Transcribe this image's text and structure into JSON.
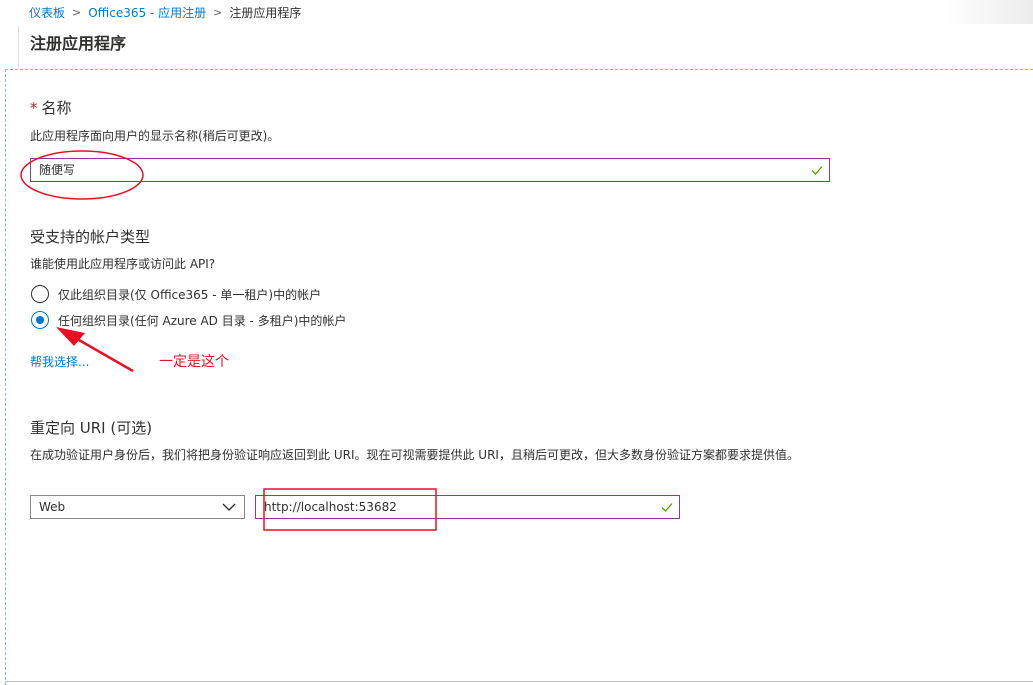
{
  "breadcrumb": {
    "items": [
      "仪表板",
      "Office365 - 应用注册"
    ],
    "current": "注册应用程序"
  },
  "page": {
    "title": "注册应用程序"
  },
  "name_section": {
    "required_mark": "*",
    "title": "名称",
    "description": "此应用程序面向用户的显示名称(稍后可更改)。",
    "value": "随便写"
  },
  "account_section": {
    "title": "受支持的帐户类型",
    "question": "谁能使用此应用程序或访问此 API?",
    "options": [
      {
        "label": "仅此组织目录(仅 Office365 - 单一租户)中的帐户",
        "selected": false
      },
      {
        "label": "任何组织目录(任何 Azure AD 目录 - 多租户)中的帐户",
        "selected": true
      }
    ],
    "help_link": "帮我选择..."
  },
  "redirect_section": {
    "title": "重定向 URI (可选)",
    "description": "在成功验证用户身份后，我们将把身份验证响应返回到此 URI。现在可视需要提供此 URI，且稍后可更改，但大多数身份验证方案都要求提供值。",
    "platform": "Web",
    "uri": "http://localhost:53682"
  },
  "annotation": {
    "text": "一定是这个",
    "color": "#e81123"
  },
  "colors": {
    "accent": "#0078d4",
    "input_border": "#8a3d8d",
    "valid_check": "#57a300"
  }
}
